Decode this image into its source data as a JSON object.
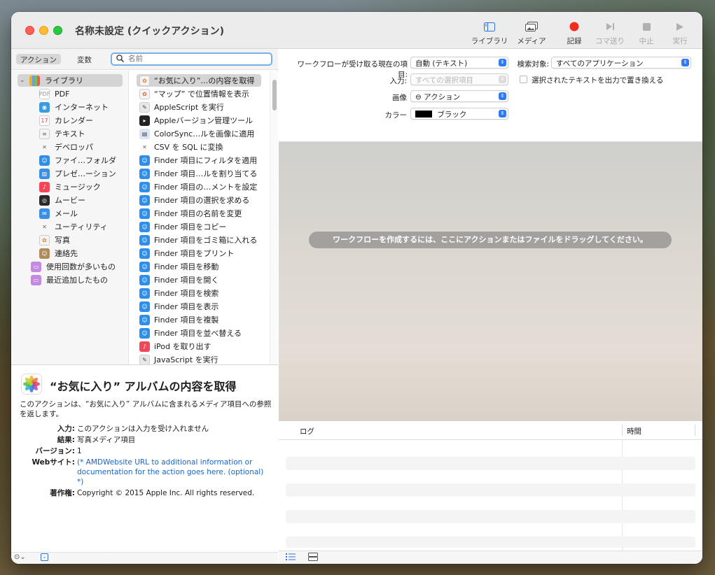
{
  "window": {
    "title": "名称未設定 (クイックアクション)"
  },
  "toolbar": {
    "library": "ライブラリ",
    "media": "メディア",
    "record": "記録",
    "step": "コマ送り",
    "stop": "中止",
    "run": "実行",
    "colors": {
      "record": "#f02b20",
      "accent": "#2f7bf5"
    }
  },
  "left": {
    "tab_actions": "アクション",
    "tab_variables": "変数",
    "search_placeholder": "名前",
    "library_root": "ライブラリ",
    "library_items": [
      {
        "label": "PDF",
        "icon": "pdf-icon"
      },
      {
        "label": "インターネット",
        "icon": "globe-icon"
      },
      {
        "label": "カレンダー",
        "icon": "calendar-icon"
      },
      {
        "label": "テキスト",
        "icon": "text-icon"
      },
      {
        "label": "デベロッパ",
        "icon": "developer-icon"
      },
      {
        "label": "ファイ…フォルダ",
        "icon": "finder-icon"
      },
      {
        "label": "プレゼ…ーション",
        "icon": "keynote-icon"
      },
      {
        "label": "ミュージック",
        "icon": "music-icon"
      },
      {
        "label": "ムービー",
        "icon": "movie-icon"
      },
      {
        "label": "メール",
        "icon": "mail-icon"
      },
      {
        "label": "ユーティリティ",
        "icon": "utility-icon"
      },
      {
        "label": "写真",
        "icon": "photos-icon"
      },
      {
        "label": "連絡先",
        "icon": "contacts-icon"
      }
    ],
    "smart_items": [
      {
        "label": "使用回数が多いもの",
        "icon": "smart-folder-icon"
      },
      {
        "label": "最近追加したもの",
        "icon": "smart-folder-icon"
      }
    ],
    "actions": [
      {
        "label": "“お気に入り”…の内容を取得",
        "icon": "photos-icon",
        "selected": true
      },
      {
        "label": "“マップ” で位置情報を表示",
        "icon": "maps-icon"
      },
      {
        "label": "AppleScript を実行",
        "icon": "applescript-icon"
      },
      {
        "label": "Appleバージョン管理ツール",
        "icon": "terminal-icon"
      },
      {
        "label": "ColorSync…ルを画像に適用",
        "icon": "colorsync-icon"
      },
      {
        "label": "CSV を SQL に変換",
        "icon": "developer-icon"
      },
      {
        "label": "Finder 項目にフィルタを適用",
        "icon": "finder-icon"
      },
      {
        "label": "Finder 項目…ルを割り当てる",
        "icon": "finder-icon"
      },
      {
        "label": "Finder 項目の…メントを設定",
        "icon": "finder-icon"
      },
      {
        "label": "Finder 項目の選択を求める",
        "icon": "finder-icon"
      },
      {
        "label": "Finder 項目の名前を変更",
        "icon": "finder-icon"
      },
      {
        "label": "Finder 項目をコピー",
        "icon": "finder-icon"
      },
      {
        "label": "Finder 項目をゴミ箱に入れる",
        "icon": "finder-icon"
      },
      {
        "label": "Finder 項目をプリント",
        "icon": "finder-icon"
      },
      {
        "label": "Finder 項目を移動",
        "icon": "finder-icon"
      },
      {
        "label": "Finder 項目を開く",
        "icon": "finder-icon"
      },
      {
        "label": "Finder 項目を検索",
        "icon": "finder-icon"
      },
      {
        "label": "Finder 項目を表示",
        "icon": "finder-icon"
      },
      {
        "label": "Finder 項目を複製",
        "icon": "finder-icon"
      },
      {
        "label": "Finder 項目を並べ替える",
        "icon": "finder-icon"
      },
      {
        "label": "iPod を取り出す",
        "icon": "music-icon"
      },
      {
        "label": "JavaScript を実行",
        "icon": "applescript-icon"
      }
    ],
    "description": {
      "title": "“お気に入り” アルバムの内容を取得",
      "text": "このアクションは、“お気に入り” アルバムに含まれるメディア項目への参照を返します。",
      "input_key": "入力:",
      "input_val": "このアクションは入力を受け入れません",
      "result_key": "結果:",
      "result_val": "写真メディア項目",
      "version_key": "バージョン:",
      "version_val": "1",
      "web_key": "Webサイト:",
      "web_val": "(* AMDWebsite URL to additional information or documentation for the action goes here. (optional) *)",
      "copyright_key": "著作権:",
      "copyright_val": "Copyright © 2015 Apple Inc. All rights reserved."
    }
  },
  "workflow": {
    "receives_label": "ワークフローが受け取る現在の項目:",
    "receives_value": "自動 (テキスト)",
    "target_label": "検索対象:",
    "target_value": "すべてのアプリケーション",
    "input_label": "入力:",
    "input_value": "すべての選択項目",
    "replace_label": "選択されたテキストを出力で置き換える",
    "image_label": "画像",
    "image_value": "⊖ アクション",
    "color_label": "カラー",
    "color_value": "ブラック",
    "drop_hint": "ワークフローを作成するには、ここにアクションまたはファイルをドラッグしてください。"
  },
  "log": {
    "col_log": "ログ",
    "col_time": "時間"
  }
}
